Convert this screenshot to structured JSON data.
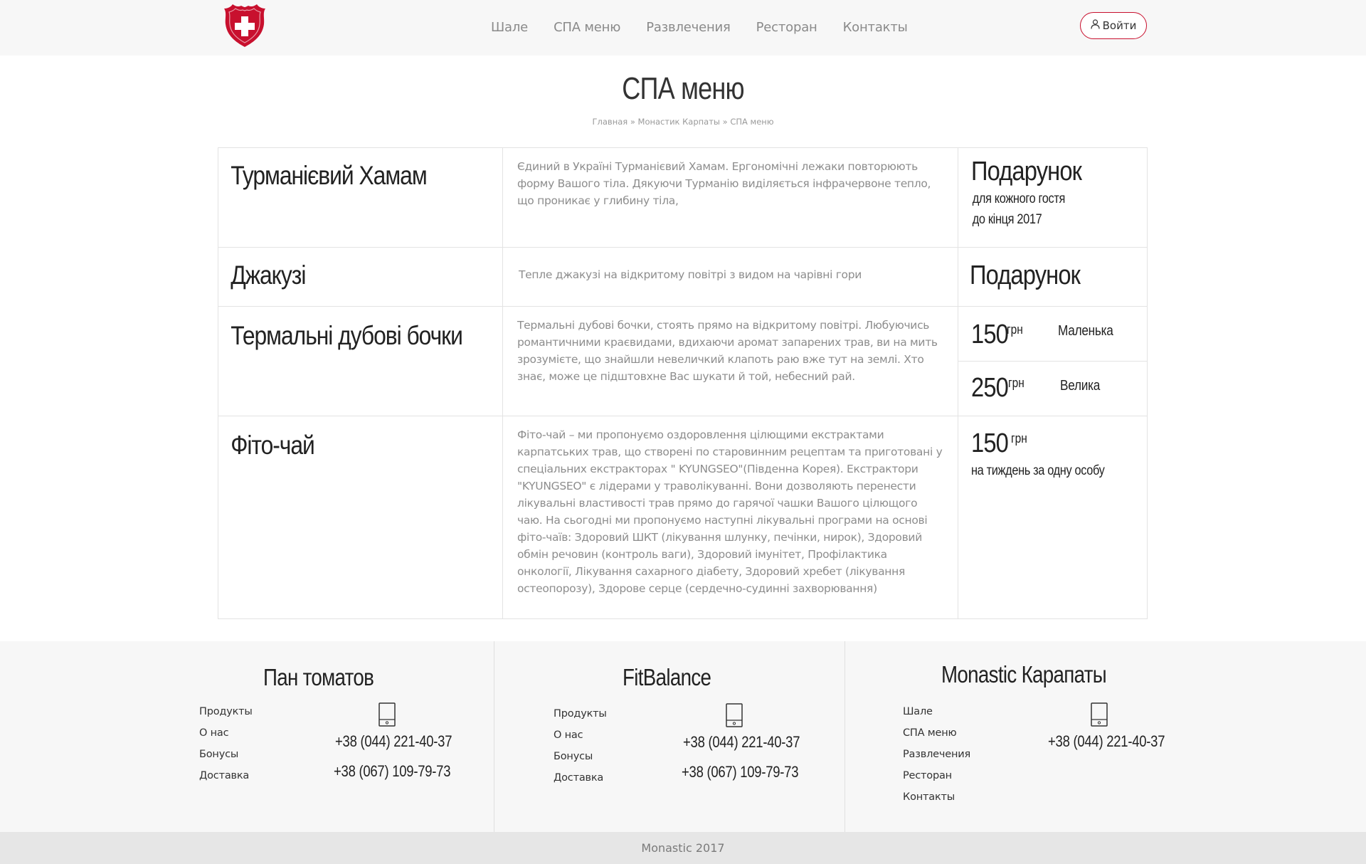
{
  "header": {
    "nav": [
      "Шале",
      "СПА меню",
      "Развлечения",
      "Ресторан",
      "Контакты"
    ],
    "login_label": "Войти",
    "brand_color": "#c8102e"
  },
  "page": {
    "title": "СПА меню",
    "breadcrumb": "Главная » Монастик Карпаты » СПА меню"
  },
  "services": [
    {
      "name": "Турманієвий Хамам",
      "description": "Єдиний в Україні Турманієвий Хамам. Ергономічні лежаки повторюють форму Вашого тіла. Дякуючи Турманію виділяється інфрачервоне тепло, що проникає у глибину тіла,",
      "price_title": "Подарунок",
      "price_note_1": "для кожного гостя",
      "price_note_2": "до кінця 2017"
    },
    {
      "name": "Джакузі",
      "description": "Тепле джакузі на відкритому повітрі з видом на чарівні гори",
      "price_title": "Подарунок"
    },
    {
      "name": "Термальні дубові бочки",
      "description": "Термальні дубові бочки, стоять прямо на відкритому повітрі. Любуючись романтичними краєвидами, вдихаючи аромат запарених трав, ви на мить зрозумієте, що знайшли невеличкий клапоть раю вже тут на землі. Хто знає, може це підштовхне Вас шукати й той, небесний рай.",
      "options": [
        {
          "price": "150",
          "currency": "грн",
          "label": "Маленька"
        },
        {
          "price": "250",
          "currency": "грн",
          "label": "Велика"
        }
      ]
    },
    {
      "name": "Фіто-чай",
      "description": "Фіто-чай – ми пропонуємо оздоровлення цілющими екстрактами карпатських трав, що створені по старовинним рецептам та приготовані у спеціальних екстракторах \" KYUNGSEO\"(Південна Корея). Екстрактори \"KYUNGSEO\" є лідерами у траволікуванні. Вони дозволяють перенести лікувальні властивості трав прямо до гарячої чашки Вашого цілющого чаю. На сьогодні ми пропонуємо наступні лікувальні програми на основі фіто-чаїв: Здоровий ШКТ (лікування шлунку, печінки, нирок), Здоровий обмін речовин (контроль ваги), Здоровий імунітет, Профілактика онкології, Лікування сахарного діабету, Здоровий хребет (лікування остеопорозу), Здорове серце (сердечно-судинні захворювання)",
      "price": "150",
      "currency": "грн",
      "price_note": "на тиждень за одну особу"
    }
  ],
  "footer": {
    "col1": {
      "title": "Пан томатов",
      "links": [
        "Продукты",
        "О нас",
        "Бонусы",
        "Доставка"
      ],
      "phones": [
        "+38 (044) 221-40-37",
        "+38 (067) 109-79-73"
      ]
    },
    "col2": {
      "title": "FitBalance",
      "links": [
        "Продукты",
        "О нас",
        "Бонусы",
        "Доставка"
      ],
      "phones": [
        "+38 (044) 221-40-37",
        "+38 (067) 109-79-73"
      ]
    },
    "col3": {
      "title": "Monastic Карапаты",
      "links": [
        "Шале",
        "СПА меню",
        "Развлечения",
        "Ресторан",
        "Контакты"
      ],
      "phones": [
        "+38 (044) 221-40-37"
      ]
    },
    "copyright": "Monastic 2017"
  }
}
